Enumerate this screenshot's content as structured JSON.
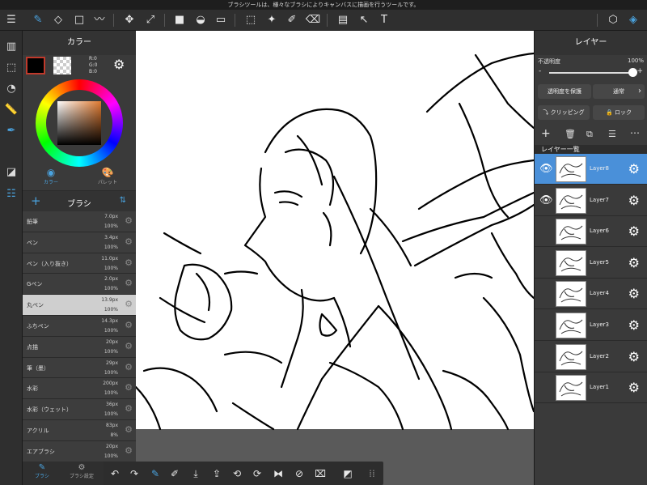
{
  "hint_text": "ブラシツールは、様々なブラシによりキャンバスに描画を行うツールです。",
  "color_panel": {
    "title": "カラー",
    "r": "R:0",
    "g": "G:0",
    "b": "B:0",
    "tab_color": "カラー",
    "tab_palette": "パレット"
  },
  "brush_panel": {
    "title": "ブラシ",
    "add_label": "+",
    "items": [
      {
        "name": "鉛筆",
        "size": "7.0px",
        "opacity": "100%"
      },
      {
        "name": "ペン",
        "size": "3.4px",
        "opacity": "100%"
      },
      {
        "name": "ペン（入り抜き）",
        "size": "11.0px",
        "opacity": "100%"
      },
      {
        "name": "Gペン",
        "size": "2.0px",
        "opacity": "100%"
      },
      {
        "name": "丸ペン",
        "size": "13.9px",
        "opacity": "100%"
      },
      {
        "name": "ふちペン",
        "size": "14.3px",
        "opacity": "100%"
      },
      {
        "name": "点描",
        "size": "20px",
        "opacity": "100%"
      },
      {
        "name": "筆（墨）",
        "size": "29px",
        "opacity": "100%"
      },
      {
        "name": "水彩",
        "size": "200px",
        "opacity": "100%"
      },
      {
        "name": "水彩（ウェット）",
        "size": "36px",
        "opacity": "100%"
      },
      {
        "name": "アクリル",
        "size": "83px",
        "opacity": "8%"
      },
      {
        "name": "エアブラシ",
        "size": "20px",
        "opacity": "100%"
      }
    ],
    "selected_index": 4
  },
  "bottom_tabs": {
    "brush": "ブラシ",
    "brush_settings": "ブラシ設定"
  },
  "layer_panel": {
    "title": "レイヤー",
    "opacity_label": "不透明度",
    "opacity_value": "100%",
    "opacity_fraction": 1.0,
    "minus": "-",
    "plus": "+",
    "protect_label": "透明度を保護",
    "blend_label": "通常",
    "clipping_label": "クリッピング",
    "lock_label": "ロック",
    "list_title": "レイヤー一覧",
    "layers": [
      {
        "name": "Layer8",
        "visible": true,
        "selected": true
      },
      {
        "name": "Layer7",
        "visible": true,
        "selected": false
      },
      {
        "name": "Layer6",
        "visible": false,
        "selected": false
      },
      {
        "name": "Layer5",
        "visible": false,
        "selected": false
      },
      {
        "name": "Layer4",
        "visible": false,
        "selected": false
      },
      {
        "name": "Layer3",
        "visible": false,
        "selected": false
      },
      {
        "name": "Layer2",
        "visible": false,
        "selected": false
      },
      {
        "name": "Layer1",
        "visible": false,
        "selected": false
      }
    ]
  },
  "colors": {
    "accent": "#4a90d9",
    "panel": "#3a3a3a",
    "canvas": "#ffffff",
    "bg": "#4a4a4a"
  },
  "icons": {
    "menu": "hamburger-icon",
    "brush": "brush-icon",
    "eraser": "eraser-icon",
    "text": "T"
  }
}
